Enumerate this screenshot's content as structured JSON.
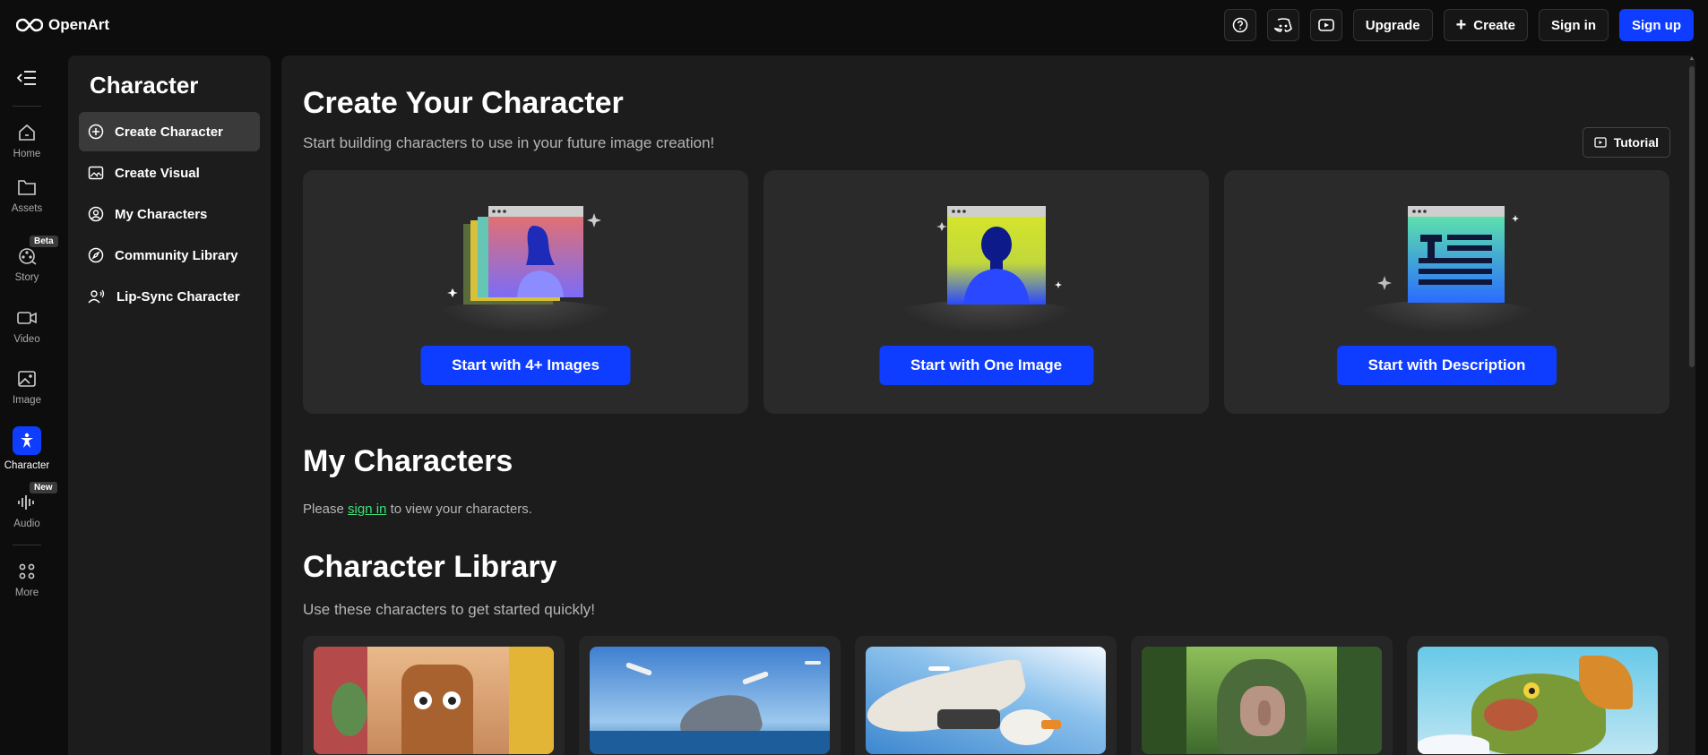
{
  "app": {
    "name": "OpenArt"
  },
  "topbar": {
    "help_icon": "question-circle",
    "discord_icon": "discord",
    "youtube_icon": "youtube",
    "upgrade": "Upgrade",
    "create": "Create",
    "sign_in": "Sign in",
    "sign_up": "Sign up"
  },
  "rail": {
    "home": "Home",
    "assets": "Assets",
    "story": "Story",
    "story_badge": "Beta",
    "video": "Video",
    "image": "Image",
    "character": "Character",
    "audio": "Audio",
    "audio_badge": "New",
    "more": "More"
  },
  "subnav": {
    "title": "Character",
    "items": [
      {
        "label": "Create Character",
        "icon": "plus-circle"
      },
      {
        "label": "Create Visual",
        "icon": "image"
      },
      {
        "label": "My Characters",
        "icon": "user-circle"
      },
      {
        "label": "Community Library",
        "icon": "compass"
      },
      {
        "label": "Lip-Sync Character",
        "icon": "speaking-person"
      }
    ]
  },
  "main": {
    "title": "Create Your Character",
    "subtitle": "Start building characters to use in your future image creation!",
    "tutorial": "Tutorial",
    "cards": [
      {
        "button": "Start with 4+ Images"
      },
      {
        "button": "Start with One Image"
      },
      {
        "button": "Start with Description"
      }
    ],
    "my_characters": {
      "title": "My Characters",
      "prefix": "Please",
      "link": "sign in",
      "suffix": "to view your characters."
    },
    "library": {
      "title": "Character Library",
      "subtitle": "Use these characters to get started quickly!"
    }
  },
  "colors": {
    "accent": "#0f3dff",
    "link": "#3ee07a",
    "panel": "#1c1c1c",
    "card": "#2a2a2a"
  }
}
